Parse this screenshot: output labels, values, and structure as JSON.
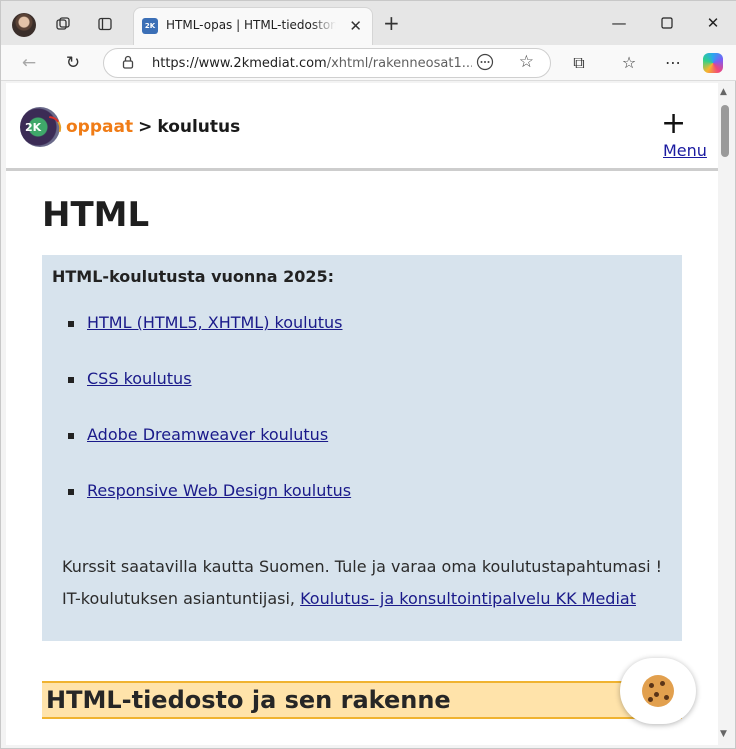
{
  "browser": {
    "tab_title": "HTML-opas | HTML-tiedoston rakenne",
    "tab_favicon_text": "2K",
    "url_host": "https://www.2kmediat.com",
    "url_path": "/xhtml/rakenneosat1....",
    "icons": [
      "profile-avatar",
      "workspaces-icon",
      "tab-actions-icon",
      "close-icon",
      "plus-icon",
      "minimize-icon",
      "maximize-icon",
      "back-icon",
      "refresh-icon",
      "lock-icon",
      "more-icon",
      "star-icon",
      "extensions-icon",
      "favorites-icon",
      "menu-icon",
      "copilot-icon"
    ]
  },
  "site": {
    "logo_text": "2K",
    "breadcrumb_root": "oppaat",
    "breadcrumb_sep": ">",
    "breadcrumb_current": "koulutus",
    "menu_plus": "+",
    "menu_label": "Menu"
  },
  "main": {
    "title": "HTML",
    "promo": {
      "heading": "HTML-koulutusta vuonna 2025:",
      "links": [
        "HTML (HTML5, XHTML) koulutus",
        "CSS koulutus",
        "Adobe Dreamweaver koulutus",
        "Responsive Web Design koulutus"
      ],
      "text": "Kurssit saatavilla kautta Suomen. Tule ja varaa oma koulutustapahtumasi ! IT-koulutuksen asiantuntijasi,",
      "text_link": "Koulutus- ja konsultointipalvelu KK Mediat"
    },
    "section_heading": "HTML-tiedosto ja sen rakenne"
  },
  "colors": {
    "accent_orange": "#f07c16",
    "promo_bg": "#d7e3ed",
    "section_bg": "#ffe3aa",
    "link": "#1a1a8a"
  }
}
